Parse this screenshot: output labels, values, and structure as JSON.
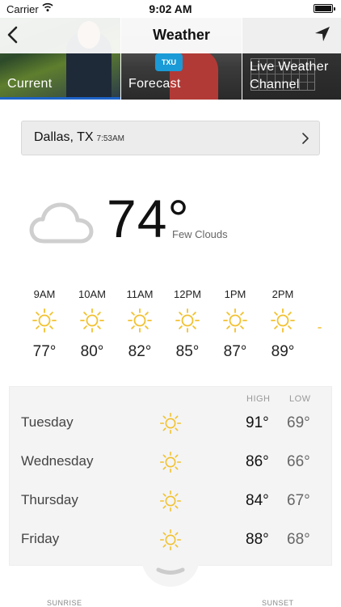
{
  "status_bar": {
    "carrier": "Carrier",
    "time": "9:02 AM"
  },
  "header": {
    "title": "Weather",
    "back_icon": "chevron-left-icon",
    "nav_icon": "location-arrow-icon",
    "accent": "#1d63c9",
    "tabs": [
      {
        "label": "Current",
        "selected": true
      },
      {
        "label": "Forecast",
        "selected": false
      },
      {
        "label": "Live Weather Channel",
        "selected": false
      }
    ]
  },
  "location": {
    "city": "Dallas, TX",
    "updated": "7:53AM"
  },
  "current": {
    "temperature": "74°",
    "condition": "Few Clouds",
    "icon": "cloud-icon"
  },
  "hourly": [
    {
      "hour": "9AM",
      "temp": "77°",
      "icon": "sun-icon"
    },
    {
      "hour": "10AM",
      "temp": "80°",
      "icon": "sun-icon"
    },
    {
      "hour": "11AM",
      "temp": "82°",
      "icon": "sun-icon"
    },
    {
      "hour": "12PM",
      "temp": "85°",
      "icon": "sun-icon"
    },
    {
      "hour": "1PM",
      "temp": "87°",
      "icon": "sun-icon"
    },
    {
      "hour": "2PM",
      "temp": "89°",
      "icon": "sun-icon"
    }
  ],
  "daily": {
    "high_label": "HIGH",
    "low_label": "LOW",
    "days": [
      {
        "day": "Tuesday",
        "high": "91°",
        "low": "69°",
        "icon": "sun-icon"
      },
      {
        "day": "Wednesday",
        "high": "86°",
        "low": "66°",
        "icon": "sun-icon"
      },
      {
        "day": "Thursday",
        "high": "84°",
        "low": "67°",
        "icon": "sun-icon"
      },
      {
        "day": "Friday",
        "high": "88°",
        "low": "68°",
        "icon": "sun-icon"
      }
    ]
  },
  "footer": {
    "sunrise_label": "SUNRISE",
    "sunset_label": "SUNSET"
  },
  "colors": {
    "sun": "#f2c12e",
    "cloud": "#cfcfcf"
  }
}
